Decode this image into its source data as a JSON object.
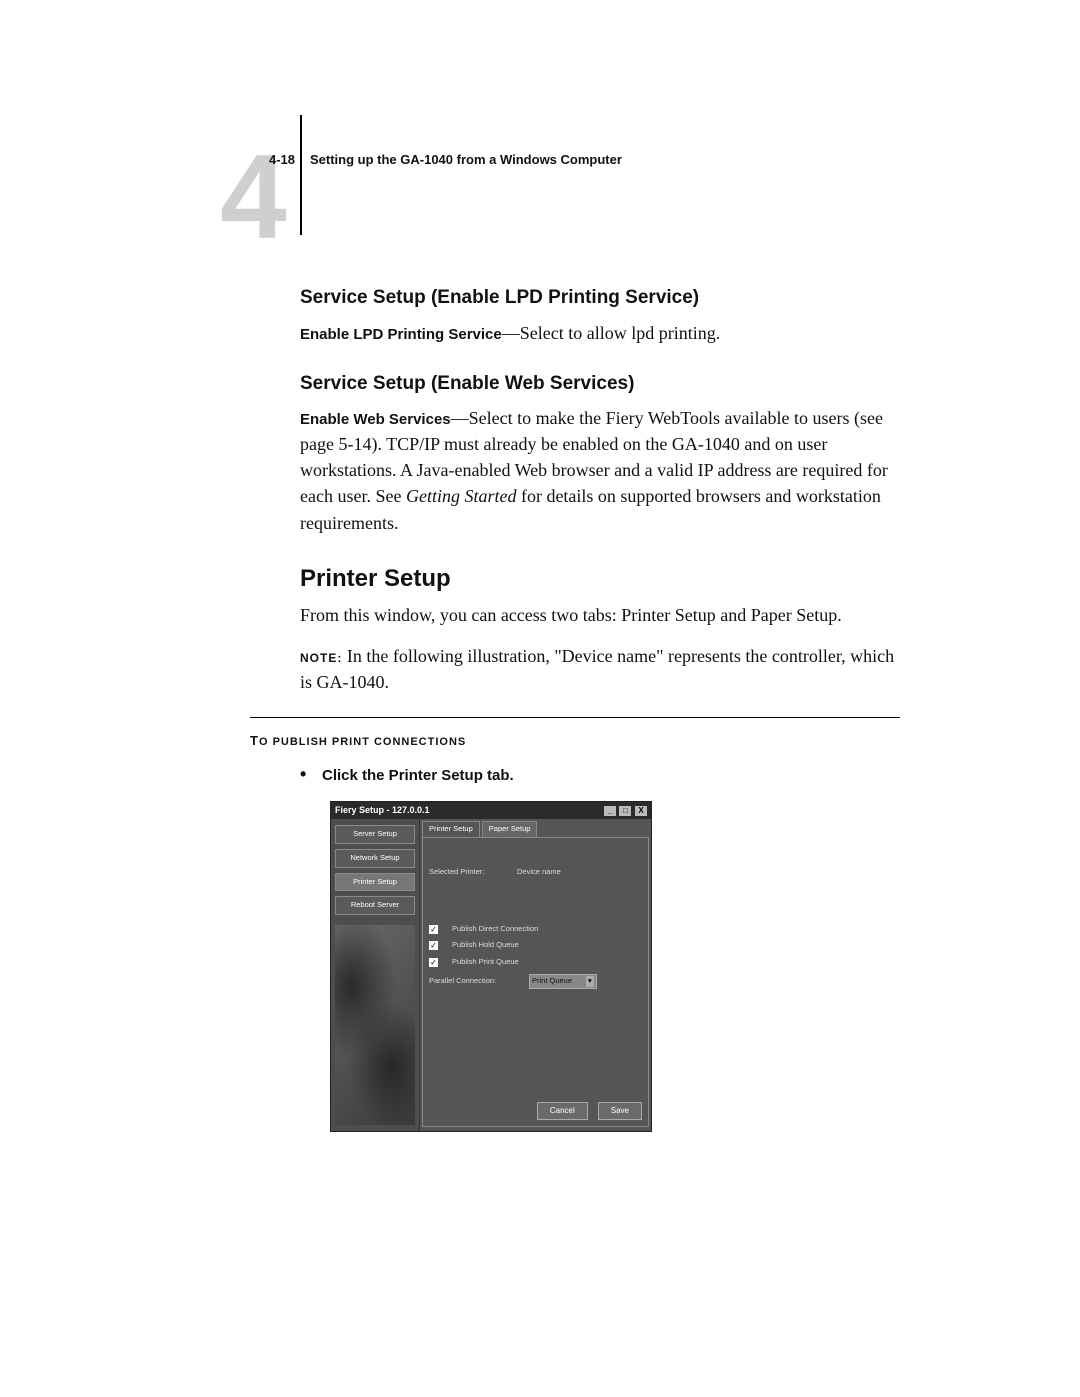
{
  "page_ref": "4-18",
  "running_title": "Setting up the GA-1040 from a Windows Computer",
  "chapter_number": "4",
  "h_lpd": "Service Setup (Enable LPD Printing Service)",
  "lpd_lead": "Enable LPD Printing Service",
  "lpd_body": "—Select to allow lpd printing.",
  "h_web": "Service Setup (Enable Web Services)",
  "web_lead": "Enable Web Services",
  "web_body_a": "—Select to make the Fiery WebTools available to users (see page 5-14). TCP/IP must already be enabled on the GA-1040 and on user workstations. A Java-enabled Web browser and a valid IP address are required for each user. See ",
  "web_body_ital": "Getting Started",
  "web_body_b": " for details on supported browsers and workstation requirements.",
  "h_printer": "Printer Setup",
  "printer_body": "From this window, you can access two tabs: Printer Setup and Paper Setup.",
  "note_label": "NOTE:",
  "note_body": " In the following illustration, \"Device name\" represents the controller, which is GA-1040.",
  "task_caps_first": "T",
  "task_caps_rest": "O PUBLISH PRINT CONNECTIONS",
  "step_bullet": "•",
  "step_text": "Click the Printer Setup tab.",
  "window": {
    "title": "Fiery Setup - 127.0.0.1",
    "ctrl_min": "_",
    "ctrl_max": "□",
    "ctrl_close": "X",
    "side_buttons": [
      "Server Setup",
      "Network Setup",
      "Printer Setup",
      "Reboot Server"
    ],
    "tabs": [
      "Printer Setup",
      "Paper Setup"
    ],
    "sel_printer_label": "Selected Printer:",
    "sel_printer_value": "Device name",
    "check1": "Publish Direct Connection",
    "check2": "Publish Hold Queue",
    "check3": "Publish Print Queue",
    "parallel_label": "Parallel Connection:",
    "parallel_value": "Print Queue",
    "cancel": "Cancel",
    "save": "Save",
    "check_mark": "✓",
    "dropdown_arrow": "▾"
  }
}
